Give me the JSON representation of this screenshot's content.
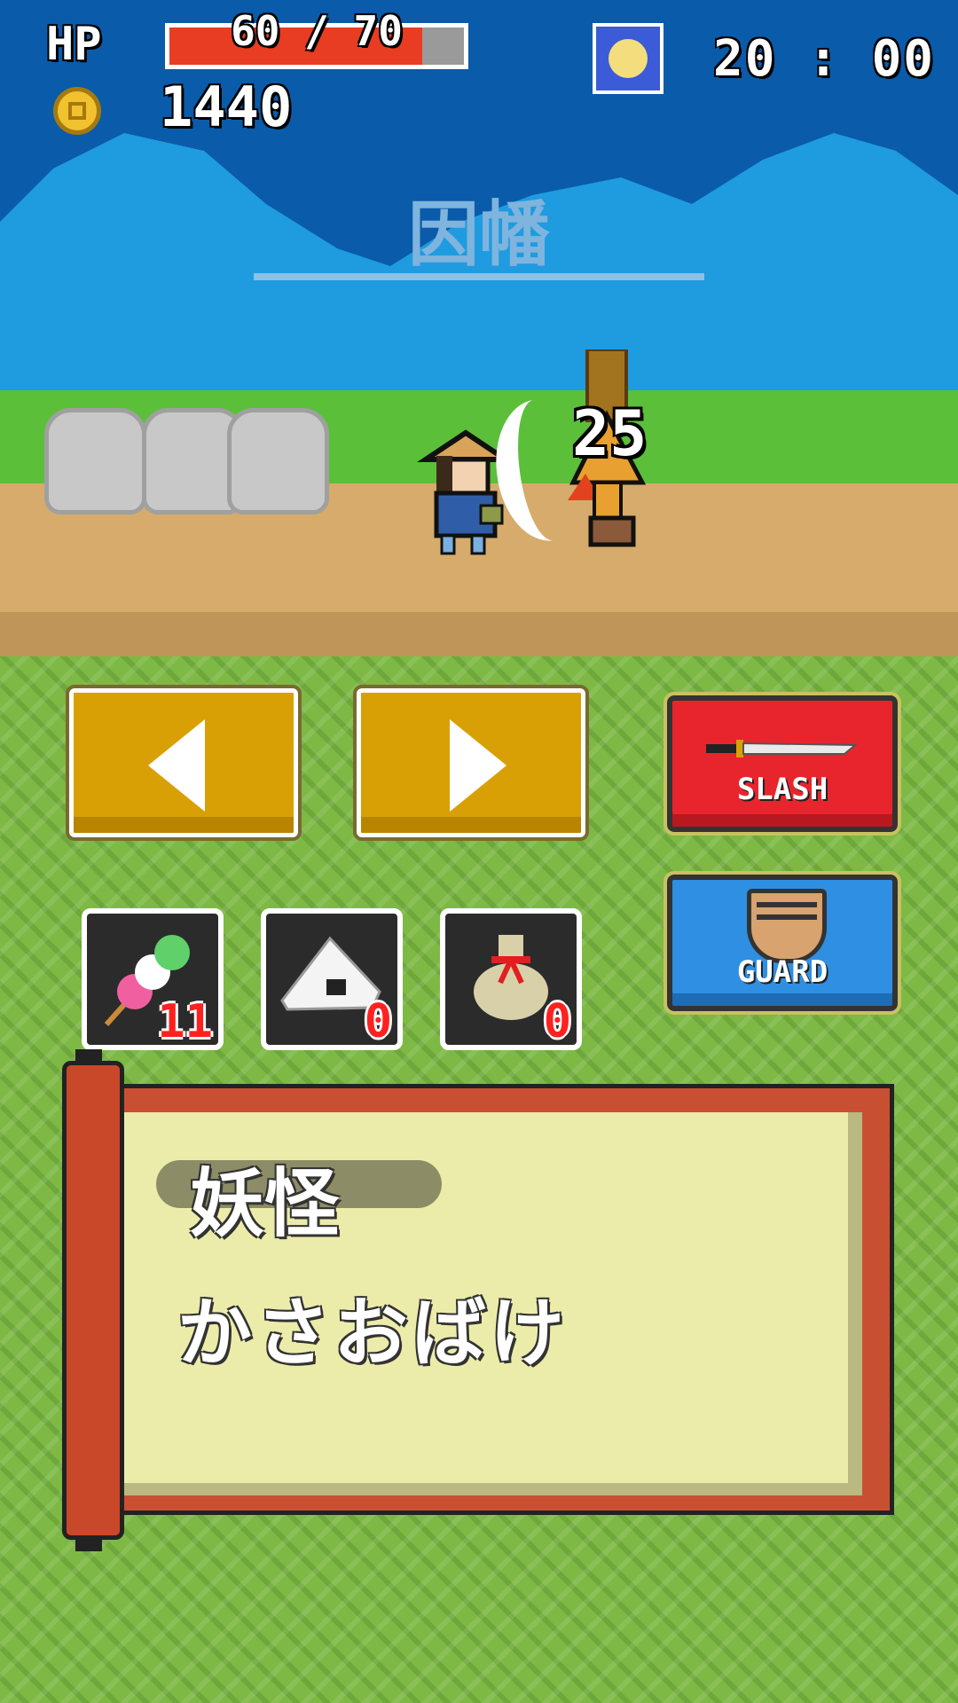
{
  "hud": {
    "hp_label": "HP",
    "hp_text": "60 / 70",
    "hp_current": 60,
    "hp_max": 70,
    "coins": "1440",
    "time": "20 : 00"
  },
  "scene": {
    "location": "因幡",
    "damage_number": "25"
  },
  "controls": {
    "slash_label": "SLASH",
    "guard_label": "GUARD"
  },
  "items": [
    {
      "name": "dango-icon",
      "count": "11"
    },
    {
      "name": "onigiri-icon",
      "count": "0"
    },
    {
      "name": "bag-icon",
      "count": "0"
    }
  ],
  "scroll": {
    "label": "妖怪",
    "enemy_name": "かさおばけ"
  },
  "colors": {
    "hp_fill": "#e83d22",
    "slash_button": "#e8252d",
    "guard_button": "#2f8fe2",
    "arrow_button": "#d9a005",
    "scroll_frame": "#c94f33",
    "scroll_paper": "#ececaa"
  }
}
